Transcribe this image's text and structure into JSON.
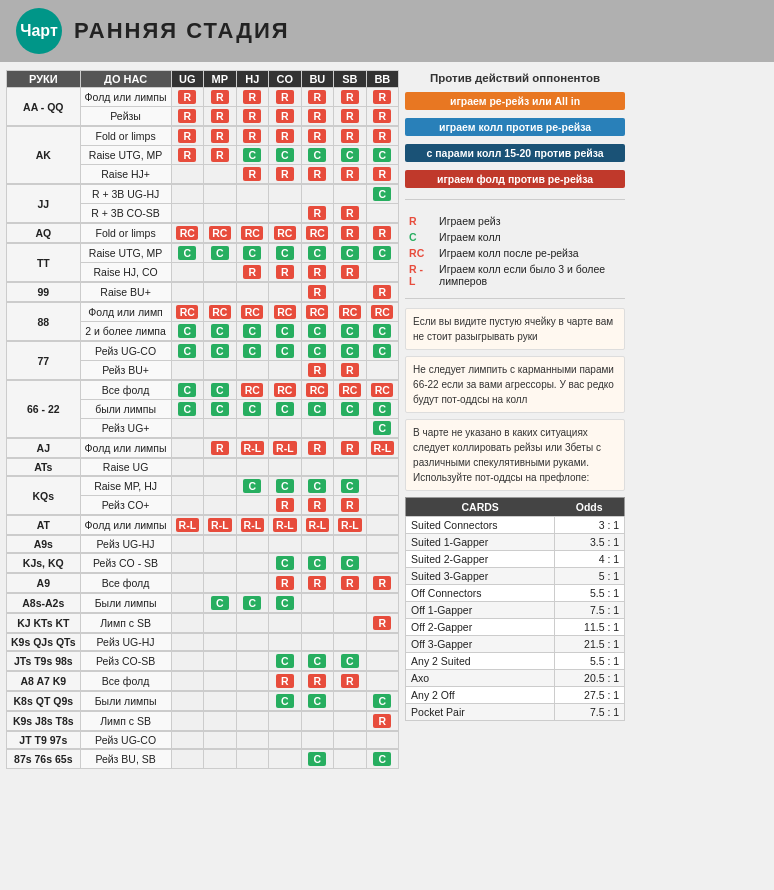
{
  "header": {
    "logo": "Чарт",
    "title": "РАННЯЯ СТАДИЯ"
  },
  "table": {
    "col_headers": [
      "РУКИ",
      "ДО НАС",
      "UG",
      "MP",
      "HJ",
      "CO",
      "BU",
      "SB",
      "BB"
    ],
    "rows": [
      {
        "hand": "AA - QQ",
        "actions": [
          {
            "desc": "Фолд или лимпы",
            "cells": [
              "R",
              "R",
              "R",
              "R",
              "R",
              "R",
              "R"
            ]
          },
          {
            "desc": "Рейзы",
            "cells": [
              "R",
              "R",
              "R",
              "R",
              "R",
              "R",
              "R"
            ]
          }
        ]
      },
      {
        "hand": "AK",
        "actions": [
          {
            "desc": "Fold or limps",
            "cells": [
              "R",
              "R",
              "R",
              "R",
              "R",
              "R",
              "R"
            ]
          },
          {
            "desc": "Raise UTG, MP",
            "cells": [
              "R",
              "R",
              "C",
              "C",
              "C",
              "C",
              "C"
            ]
          },
          {
            "desc": "Raise HJ+",
            "cells": [
              "",
              "",
              "R",
              "R",
              "R",
              "R",
              "R"
            ]
          }
        ]
      },
      {
        "hand": "JJ",
        "actions": [
          {
            "desc": "R + 3B UG-HJ",
            "cells": [
              "",
              "",
              "",
              "",
              "",
              "",
              "C"
            ]
          },
          {
            "desc": "R + 3B CO-SB",
            "cells": [
              "",
              "",
              "",
              "",
              "R",
              "R",
              ""
            ]
          }
        ]
      },
      {
        "hand": "AQ",
        "actions": [
          {
            "desc": "Fold or limps",
            "cells": [
              "RC",
              "RC",
              "RC",
              "RC",
              "RC",
              "R",
              "R"
            ]
          }
        ]
      },
      {
        "hand": "TT",
        "actions": [
          {
            "desc": "Raise UTG, MP",
            "cells": [
              "C",
              "C",
              "C",
              "C",
              "C",
              "C",
              "C"
            ]
          },
          {
            "desc": "Raise HJ, CO",
            "cells": [
              "",
              "",
              "R",
              "R",
              "R",
              "R",
              ""
            ]
          }
        ]
      },
      {
        "hand": "99",
        "actions": [
          {
            "desc": "Raise BU+",
            "cells": [
              "",
              "",
              "",
              "",
              "R",
              "",
              "R"
            ]
          }
        ]
      },
      {
        "hand": "88",
        "actions": [
          {
            "desc": "Фолд или лимп",
            "cells": [
              "RC",
              "RC",
              "RC",
              "RC",
              "RC",
              "RC",
              "RC"
            ]
          },
          {
            "desc": "2 и более лимпа",
            "cells": [
              "C",
              "C",
              "C",
              "C",
              "C",
              "C",
              "C"
            ]
          }
        ]
      },
      {
        "hand": "77",
        "actions": [
          {
            "desc": "Рейз UG-CO",
            "cells": [
              "C",
              "C",
              "C",
              "C",
              "C",
              "C",
              "C"
            ]
          },
          {
            "desc": "Рейз BU+",
            "cells": [
              "",
              "",
              "",
              "",
              "R",
              "R",
              ""
            ]
          }
        ]
      },
      {
        "hand": "66 - 22",
        "actions": [
          {
            "desc": "Все фолд",
            "cells": [
              "C",
              "C",
              "RC",
              "RC",
              "RC",
              "RC",
              "RC"
            ]
          },
          {
            "desc": "были лимпы",
            "cells": [
              "C",
              "C",
              "C",
              "C",
              "C",
              "C",
              "C"
            ]
          },
          {
            "desc": "Рейз UG+",
            "cells": [
              "",
              "",
              "",
              "",
              "",
              "",
              "C"
            ]
          }
        ]
      },
      {
        "hand": "AJ",
        "actions": [
          {
            "desc": "Фолд или лимпы",
            "cells": [
              "",
              "R",
              "R-L",
              "R-L",
              "R",
              "R",
              "R-L"
            ]
          }
        ]
      },
      {
        "hand": "ATs",
        "actions": [
          {
            "desc": "Raise UG",
            "cells": [
              "",
              "",
              "",
              "",
              "",
              "",
              ""
            ]
          }
        ]
      },
      {
        "hand": "KQs",
        "actions": [
          {
            "desc": "Raise MP, HJ",
            "cells": [
              "",
              "",
              "C",
              "C",
              "C",
              "C",
              ""
            ]
          },
          {
            "desc": "Рейз CO+",
            "cells": [
              "",
              "",
              "",
              "R",
              "R",
              "R",
              ""
            ]
          }
        ]
      },
      {
        "hand": "AT",
        "actions": [
          {
            "desc": "Фолд или лимпы",
            "cells": [
              "R-L",
              "R-L",
              "R-L",
              "R-L",
              "R-L",
              "R-L",
              ""
            ]
          }
        ]
      },
      {
        "hand": "A9s",
        "actions": [
          {
            "desc": "Рейз UG-HJ",
            "cells": [
              "",
              "",
              "",
              "",
              "",
              "",
              ""
            ]
          }
        ]
      },
      {
        "hand": "KJs, KQ",
        "actions": [
          {
            "desc": "Рейз CO - SB",
            "cells": [
              "",
              "",
              "",
              "C",
              "C",
              "C",
              ""
            ]
          }
        ]
      },
      {
        "hand": "A9",
        "actions": [
          {
            "desc": "Все фолд",
            "cells": [
              "",
              "",
              "",
              "R",
              "R",
              "R",
              "R"
            ]
          }
        ]
      },
      {
        "hand": "A8s-A2s",
        "actions": [
          {
            "desc": "Были лимпы",
            "cells": [
              "",
              "C",
              "C",
              "C",
              "",
              "",
              ""
            ]
          }
        ]
      },
      {
        "hand": "KJ  KTs  KT",
        "actions": [
          {
            "desc": "Лимп с SB",
            "cells": [
              "",
              "",
              "",
              "",
              "",
              "",
              "R"
            ]
          }
        ]
      },
      {
        "hand": "K9s  QJs  QTs",
        "actions": [
          {
            "desc": "Рейз UG-HJ",
            "cells": [
              "",
              "",
              "",
              "",
              "",
              "",
              ""
            ]
          }
        ]
      },
      {
        "hand": "JTs  T9s  98s",
        "actions": [
          {
            "desc": "Рейз CO-SB",
            "cells": [
              "",
              "",
              "",
              "C",
              "C",
              "C",
              ""
            ]
          }
        ]
      },
      {
        "hand": "A8  A7  K9",
        "actions": [
          {
            "desc": "Все фолд",
            "cells": [
              "",
              "",
              "",
              "R",
              "R",
              "R",
              ""
            ]
          }
        ]
      },
      {
        "hand": "K8s  QT  Q9s",
        "actions": [
          {
            "desc": "Были лимпы",
            "cells": [
              "",
              "",
              "",
              "C",
              "C",
              "",
              "C"
            ]
          }
        ]
      },
      {
        "hand": "K9s  J8s  T8s",
        "actions": [
          {
            "desc": "Лимп с SB",
            "cells": [
              "",
              "",
              "",
              "",
              "",
              "",
              "R"
            ]
          }
        ]
      },
      {
        "hand": "JT  T9  97s",
        "actions": [
          {
            "desc": "Рейз UG-CO",
            "cells": [
              "",
              "",
              "",
              "",
              "",
              "",
              ""
            ]
          }
        ]
      },
      {
        "hand": "87s  76s  65s",
        "actions": [
          {
            "desc": "Рейз BU, SB",
            "cells": [
              "",
              "",
              "",
              "",
              "C",
              "",
              "C"
            ]
          }
        ]
      }
    ]
  },
  "right": {
    "vs_opponents_title": "Против действий оппонентов",
    "legend_items": [
      {
        "label": "играем ре-рейз или All in",
        "color": "orange"
      },
      {
        "label": "играем колл против ре-рейза",
        "color": "blue"
      },
      {
        "label": "с парами колл 15-20 против рейза",
        "color": "darkblue"
      },
      {
        "label": "играем фолд против ре-рейза",
        "color": "red"
      }
    ],
    "abbr": [
      {
        "code": "R",
        "color": "red",
        "desc": "Играем рейз"
      },
      {
        "code": "C",
        "color": "green",
        "desc": "Играем колл"
      },
      {
        "code": "RC",
        "color": "red",
        "desc": "Играем колл после ре-рейза"
      },
      {
        "code": "R - L",
        "color": "red",
        "desc": "Играем колл если было 3 и более лимперов"
      }
    ],
    "note1": "Если вы видите пустую ячейку в чарте\nвам не стоит разыгрывать руки",
    "note2": "Не следует лимпить с карманными\nпарами 66-22 если за вами агрессоры.\nУ вас редко будут пот-оддсы на колл",
    "note3": "В чарте не указано в каких ситуациях\nследует коллировать рейзы или 3беты\nс различными спекулятивными руками.\nИспользуйте пот-оддсы на префлопе:",
    "cards_table": {
      "headers": [
        "CARDS",
        "Odds"
      ],
      "rows": [
        {
          "hand": "Suited Connectors",
          "odds": "3 : 1"
        },
        {
          "hand": "Suited 1-Gapper",
          "odds": "3.5 : 1"
        },
        {
          "hand": "Suited 2-Gapper",
          "odds": "4 : 1"
        },
        {
          "hand": "Suited 3-Gapper",
          "odds": "5 : 1"
        },
        {
          "hand": "Off Connectors",
          "odds": "5.5 : 1"
        },
        {
          "hand": "Off 1-Gapper",
          "odds": "7.5 : 1"
        },
        {
          "hand": "Off 2-Gapper",
          "odds": "11.5 : 1"
        },
        {
          "hand": "Off 3-Gapper",
          "odds": "21.5 : 1"
        },
        {
          "hand": "Any 2 Suited",
          "odds": "5.5 : 1"
        },
        {
          "hand": "Axo",
          "odds": "20.5 : 1"
        },
        {
          "hand": "Any 2 Off",
          "odds": "27.5 : 1"
        },
        {
          "hand": "Pocket Pair",
          "odds": "7.5 : 1"
        }
      ]
    }
  }
}
